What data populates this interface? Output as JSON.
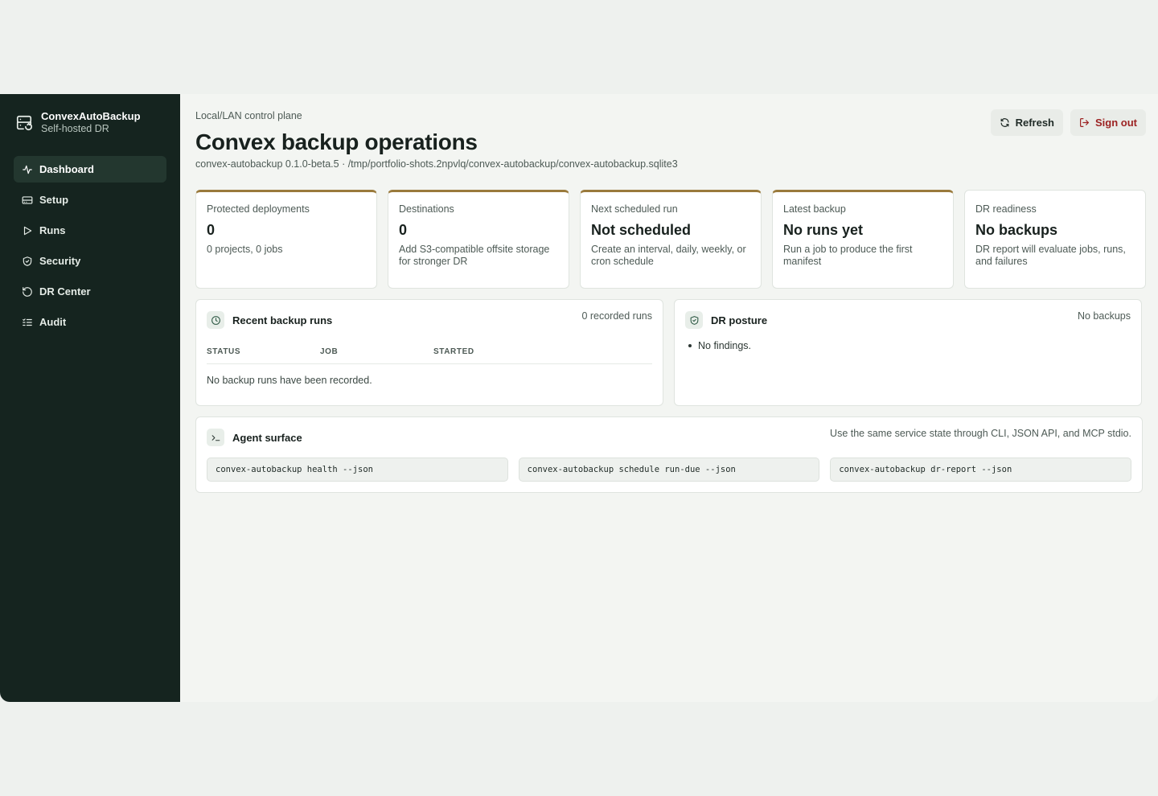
{
  "brand": {
    "name": "ConvexAutoBackup",
    "subtitle": "Self-hosted DR"
  },
  "sidebar": {
    "items": [
      {
        "label": "Dashboard",
        "icon": "activity-icon",
        "active": true
      },
      {
        "label": "Setup",
        "icon": "drive-icon",
        "active": false
      },
      {
        "label": "Runs",
        "icon": "play-icon",
        "active": false
      },
      {
        "label": "Security",
        "icon": "shield-icon",
        "active": false
      },
      {
        "label": "DR Center",
        "icon": "history-icon",
        "active": false
      },
      {
        "label": "Audit",
        "icon": "list-check-icon",
        "active": false
      }
    ]
  },
  "header": {
    "eyebrow": "Local/LAN control plane",
    "title": "Convex backup operations",
    "subtitle": "convex-autobackup 0.1.0-beta.5 · /tmp/portfolio-shots.2npvlq/convex-autobackup/convex-autobackup.sqlite3",
    "refresh_label": "Refresh",
    "signout_label": "Sign out"
  },
  "stats": [
    {
      "label": "Protected deployments",
      "value": "0",
      "note": "0 projects, 0 jobs"
    },
    {
      "label": "Destinations",
      "value": "0",
      "note": "Add S3-compatible offsite storage for stronger DR"
    },
    {
      "label": "Next scheduled run",
      "value": "Not scheduled",
      "note": "Create an interval, daily, weekly, or cron schedule"
    },
    {
      "label": "Latest backup",
      "value": "No runs yet",
      "note": "Run a job to produce the first manifest"
    },
    {
      "label": "DR readiness",
      "value": "No backups",
      "note": "DR report will evaluate jobs, runs, and failures"
    }
  ],
  "runs_panel": {
    "title": "Recent backup runs",
    "meta": "0 recorded runs",
    "columns": [
      "STATUS",
      "JOB",
      "STARTED"
    ],
    "empty": "No backup runs have been recorded."
  },
  "posture_panel": {
    "title": "DR posture",
    "meta": "No backups",
    "findings": [
      "No findings."
    ]
  },
  "agent_panel": {
    "title": "Agent surface",
    "meta": "Use the same service state through CLI, JSON API, and MCP stdio.",
    "commands": [
      "convex-autobackup health --json",
      "convex-autobackup schedule run-due --json",
      "convex-autobackup dr-report --json"
    ]
  },
  "colors": {
    "sidebar_bg": "#15241f",
    "accent_gold": "#9a7a3c",
    "signout_red": "#9c2222"
  }
}
